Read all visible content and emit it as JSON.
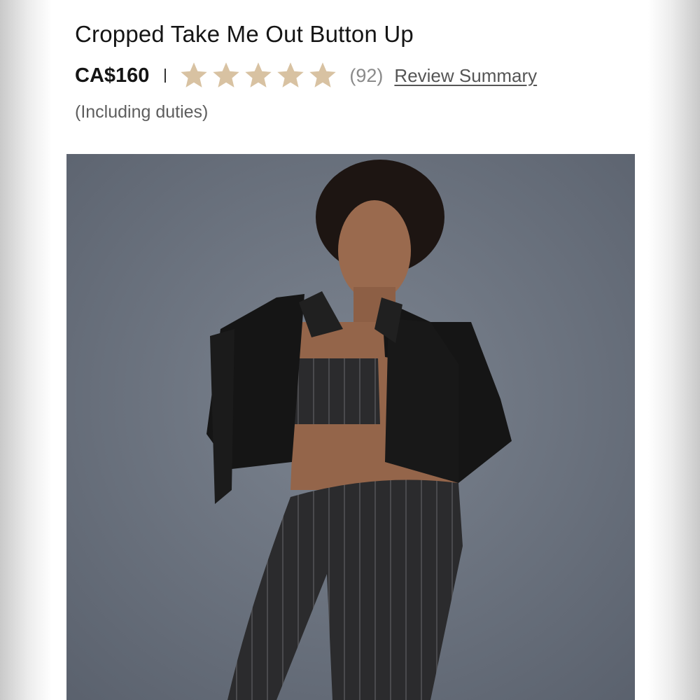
{
  "product": {
    "title": "Cropped Take Me Out Button Up",
    "price": "CA$160",
    "rating_stars": 5,
    "review_count": "(92)",
    "review_summary_label": "Review Summary",
    "duties_note": "(Including duties)"
  },
  "colors": {
    "star_fill": "#d8c2a2",
    "photo_background": "#6b7380",
    "garment": "#151515"
  },
  "icons": [
    "star-icon"
  ]
}
